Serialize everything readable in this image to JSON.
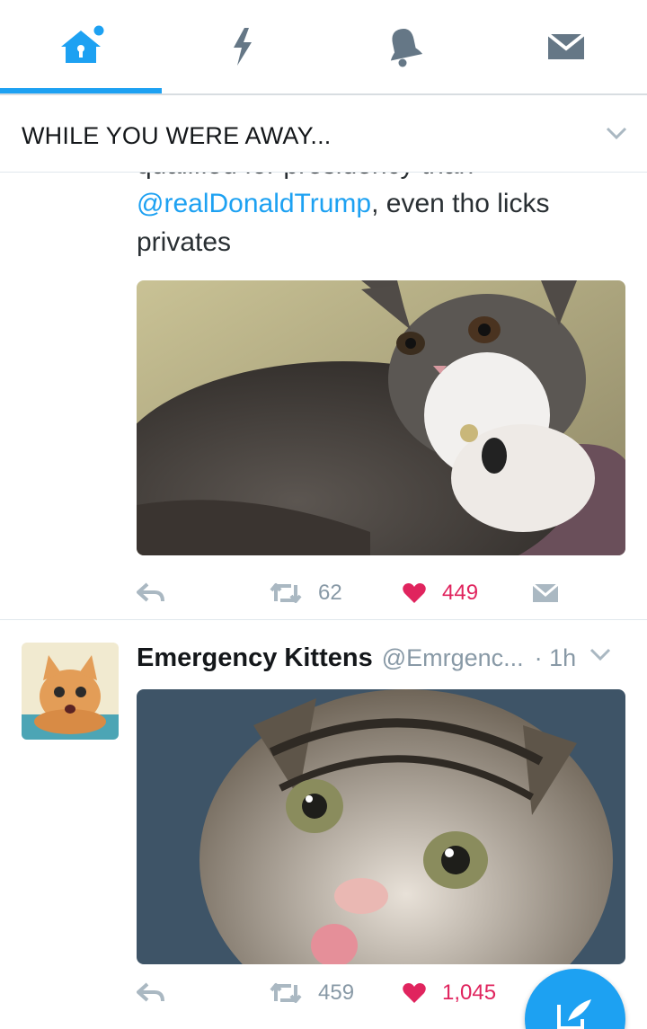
{
  "nav": {
    "tabs": [
      {
        "name": "home",
        "icon": "home-icon",
        "active": true
      },
      {
        "name": "moments",
        "icon": "lightning-icon",
        "active": false
      },
      {
        "name": "notifications",
        "icon": "bell-icon",
        "active": false
      },
      {
        "name": "messages",
        "icon": "envelope-icon",
        "active": false
      }
    ],
    "accent": "#1da1f2",
    "inactive_color": "#657786"
  },
  "section": {
    "title": "WHILE YOU WERE AWAY..."
  },
  "tweet1": {
    "text_line_clipped": "qualified for presidency than",
    "mention": "@realDonaldTrump",
    "text_after_mention": ", even tho licks",
    "text_line_3": "privates",
    "media_icon": "cat-photo-grey-white",
    "retweets": "62",
    "likes": "449"
  },
  "tweet2": {
    "name": "Emergency Kittens",
    "handle": "@Emrgenc...",
    "time": "· 1h",
    "avatar_icon": "kitten-avatar",
    "media_icon": "cat-photo-tabby-kitten",
    "retweets": "459",
    "likes": "1,045"
  },
  "colors": {
    "like_red": "#e0245e",
    "gray": "#8899a6",
    "divider": "#e1e8ed"
  },
  "fab": {
    "icon": "compose-icon"
  }
}
